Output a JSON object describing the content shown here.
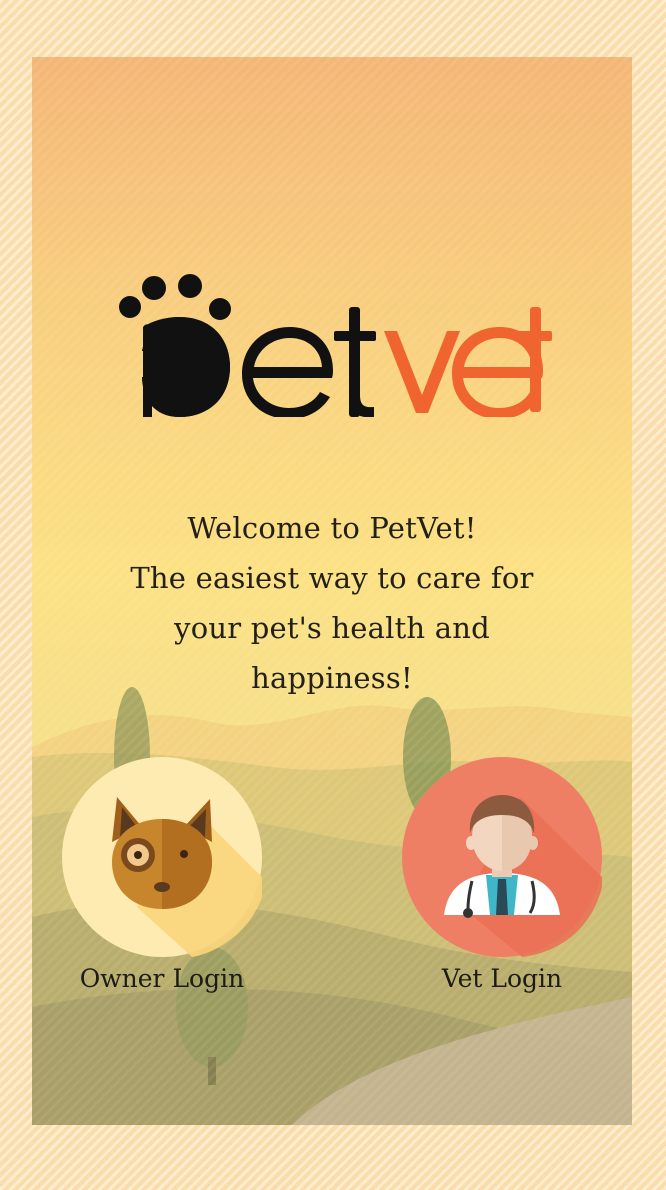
{
  "logo": {
    "text_part1": "pet",
    "text_part2": "vet",
    "color_dark": "#111111",
    "color_accent": "#f0642f"
  },
  "welcome": {
    "line1": "Welcome to PetVet!",
    "line2": "The easiest way to care for",
    "line3": "your pet's health and",
    "line4": "happiness!"
  },
  "owner_login": {
    "label": "Owner Login",
    "icon": "dog-icon",
    "circle_color": "#fdebb2"
  },
  "vet_login": {
    "label": "Vet Login",
    "icon": "doctor-icon",
    "circle_color": "#ef7f64"
  }
}
